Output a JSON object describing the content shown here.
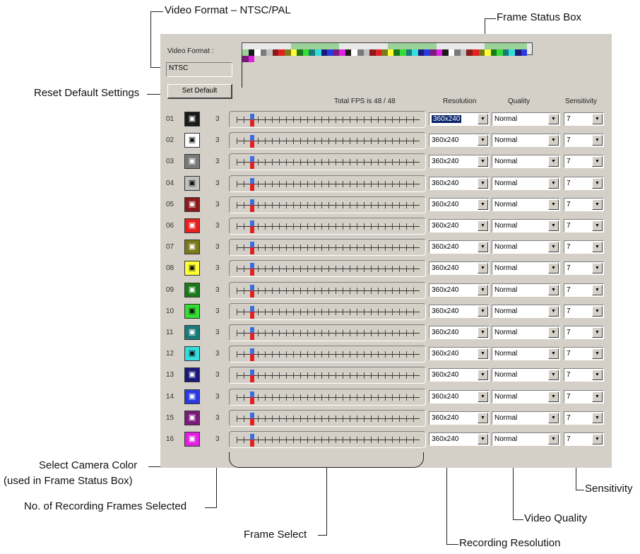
{
  "callouts": {
    "video_format": "Video Format – NTSC/PAL",
    "frame_status_box": "Frame Status Box",
    "reset_default": "Reset Default Settings",
    "select_camera_color": "Select Camera Color",
    "select_camera_color_note": "(used in Frame Status Box)",
    "no_recording_frames": "No. of Recording Frames Selected",
    "frame_select": "Frame Select",
    "recording_resolution": "Recording Resolution",
    "video_quality": "Video Quality",
    "sensitivity": "Sensitivity"
  },
  "panel": {
    "video_format_label": "Video Format :",
    "video_format_value": "NTSC",
    "set_default_label": "Set Default",
    "total_fps": "Total FPS is 48 / 48",
    "col_resolution": "Resolution",
    "col_quality": "Quality",
    "col_sensitivity": "Sensitivity"
  },
  "frame_status_colors": [
    "#1a1a1a",
    "#ffffff",
    "#7a7a7a",
    "#c0c0c0",
    "#8b1a1a",
    "#e62020",
    "#7a7a1a",
    "#ffff33",
    "#1a7a1a",
    "#33dd33",
    "#1a7a7a",
    "#33dddd",
    "#1a1a7a",
    "#2a3ae0",
    "#7a1a7a",
    "#e020e0"
  ],
  "cameras": [
    {
      "num": "01",
      "color": "#1a1a1a",
      "frames": "3",
      "resolution": "360x240",
      "quality": "Normal",
      "sensitivity": "7",
      "res_selected": true
    },
    {
      "num": "02",
      "color": "#ffffff",
      "frames": "3",
      "resolution": "360x240",
      "quality": "Normal",
      "sensitivity": "7"
    },
    {
      "num": "03",
      "color": "#7a7a7a",
      "frames": "3",
      "resolution": "360x240",
      "quality": "Normal",
      "sensitivity": "7"
    },
    {
      "num": "04",
      "color": "#c0c0c0",
      "frames": "3",
      "resolution": "360x240",
      "quality": "Normal",
      "sensitivity": "7"
    },
    {
      "num": "05",
      "color": "#8b1a1a",
      "frames": "3",
      "resolution": "360x240",
      "quality": "Normal",
      "sensitivity": "7"
    },
    {
      "num": "06",
      "color": "#e62020",
      "frames": "3",
      "resolution": "360x240",
      "quality": "Normal",
      "sensitivity": "7"
    },
    {
      "num": "07",
      "color": "#7a7a1a",
      "frames": "3",
      "resolution": "360x240",
      "quality": "Normal",
      "sensitivity": "7"
    },
    {
      "num": "08",
      "color": "#ffff33",
      "frames": "3",
      "resolution": "360x240",
      "quality": "Normal",
      "sensitivity": "7"
    },
    {
      "num": "09",
      "color": "#1a7a1a",
      "frames": "3",
      "resolution": "360x240",
      "quality": "Normal",
      "sensitivity": "7"
    },
    {
      "num": "10",
      "color": "#33dd33",
      "frames": "3",
      "resolution": "360x240",
      "quality": "Normal",
      "sensitivity": "7"
    },
    {
      "num": "11",
      "color": "#1a7a7a",
      "frames": "3",
      "resolution": "360x240",
      "quality": "Normal",
      "sensitivity": "7"
    },
    {
      "num": "12",
      "color": "#33dddd",
      "frames": "3",
      "resolution": "360x240",
      "quality": "Normal",
      "sensitivity": "7"
    },
    {
      "num": "13",
      "color": "#1a1a7a",
      "frames": "3",
      "resolution": "360x240",
      "quality": "Normal",
      "sensitivity": "7"
    },
    {
      "num": "14",
      "color": "#2a3ae0",
      "frames": "3",
      "resolution": "360x240",
      "quality": "Normal",
      "sensitivity": "7"
    },
    {
      "num": "15",
      "color": "#7a1a7a",
      "frames": "3",
      "resolution": "360x240",
      "quality": "Normal",
      "sensitivity": "7"
    },
    {
      "num": "16",
      "color": "#e020e0",
      "frames": "3",
      "resolution": "360x240",
      "quality": "Normal",
      "sensitivity": "7"
    }
  ],
  "icons": {
    "camera": "video-camera-icon",
    "dropdown": "triangle-down-icon"
  }
}
